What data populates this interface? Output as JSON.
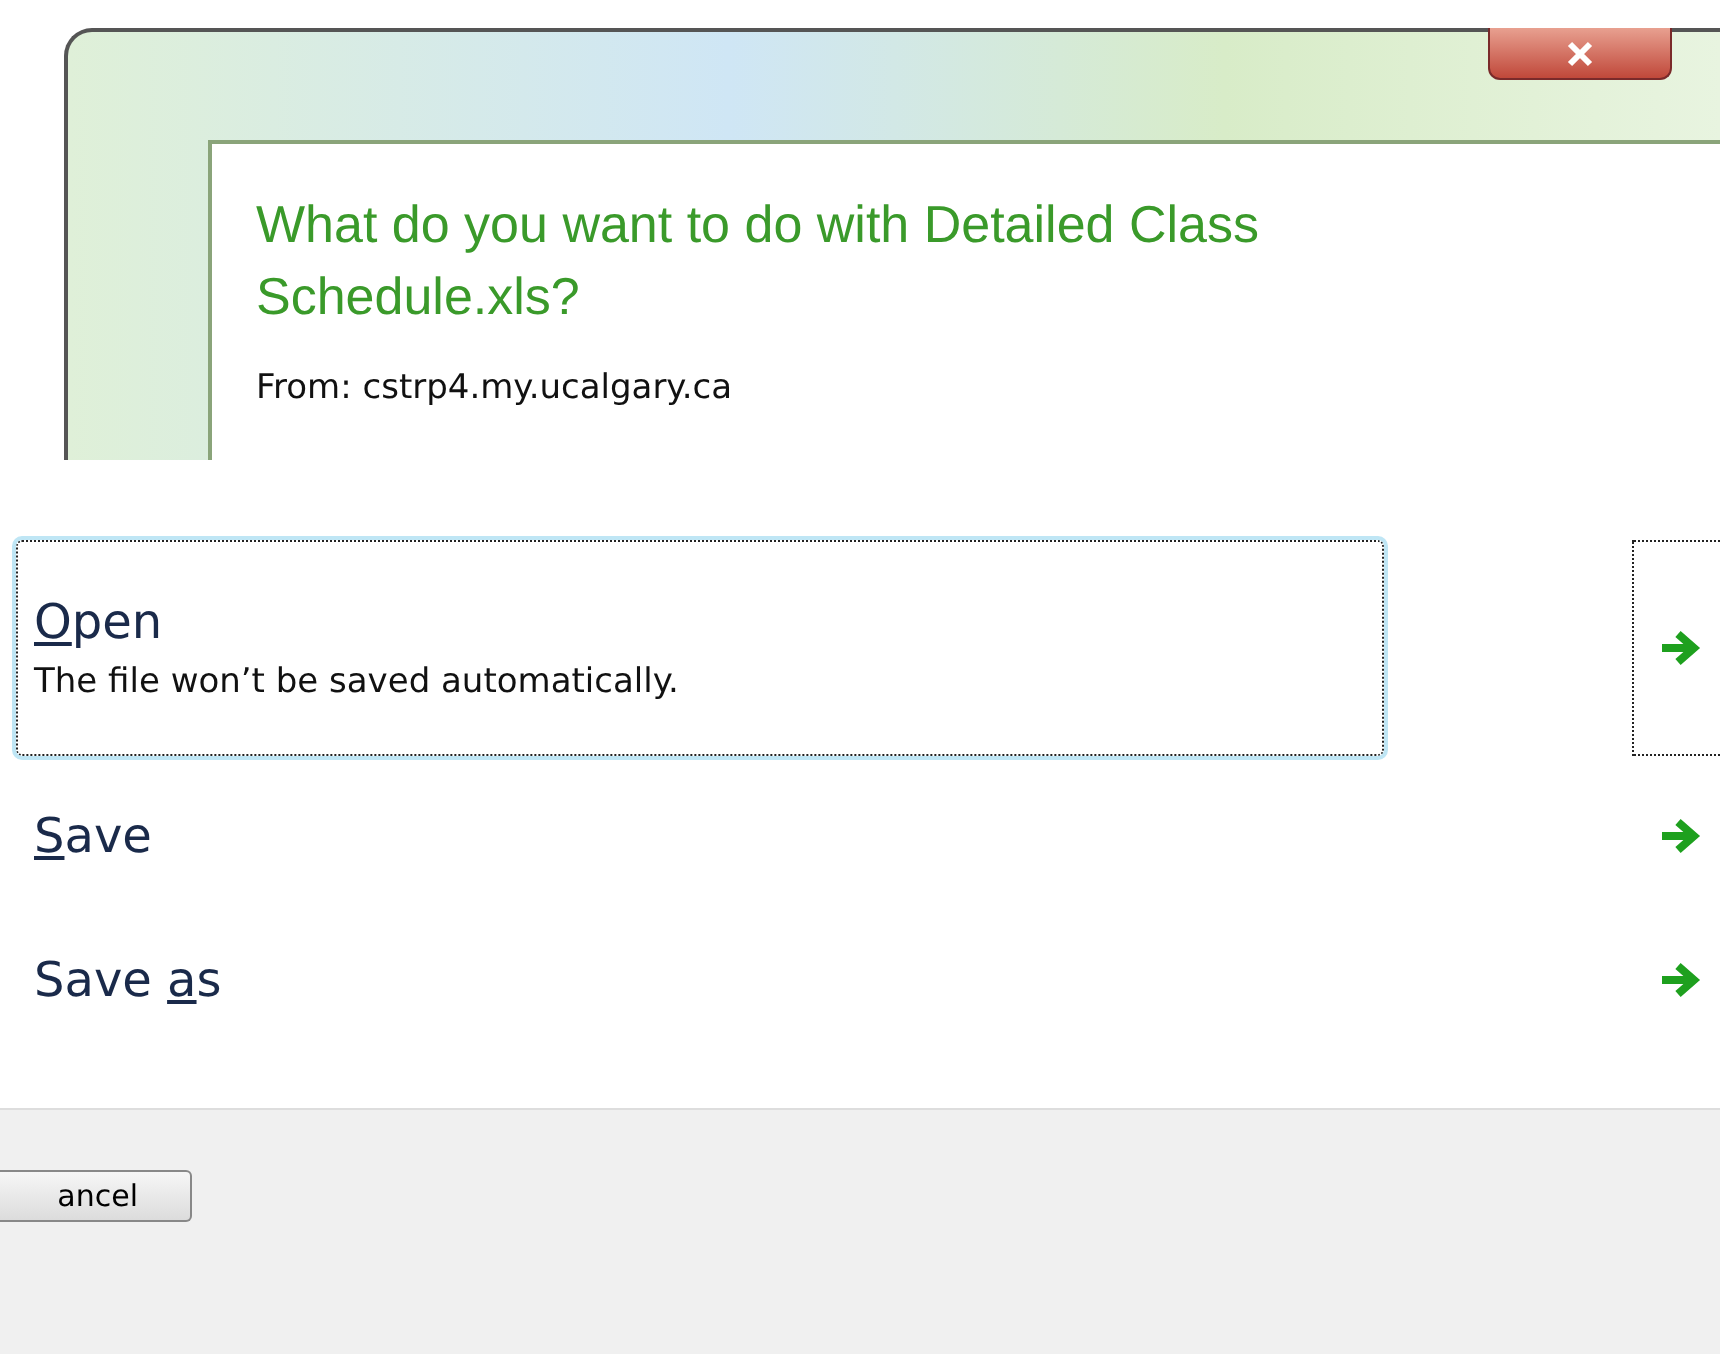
{
  "heading": "What do you want to do with Detailed Class Schedule.xls?",
  "source": "From: cstrp4.my.ucalgary.ca",
  "options": [
    {
      "hotkey": "O",
      "after": "pen",
      "description": "The file won’t be saved automatically.",
      "selected": true
    },
    {
      "hotkey": "S",
      "after": "ave",
      "selected": false
    },
    {
      "before": "Save ",
      "hotkey": "a",
      "after": "s",
      "selected": false
    }
  ],
  "cancel": "ancel"
}
